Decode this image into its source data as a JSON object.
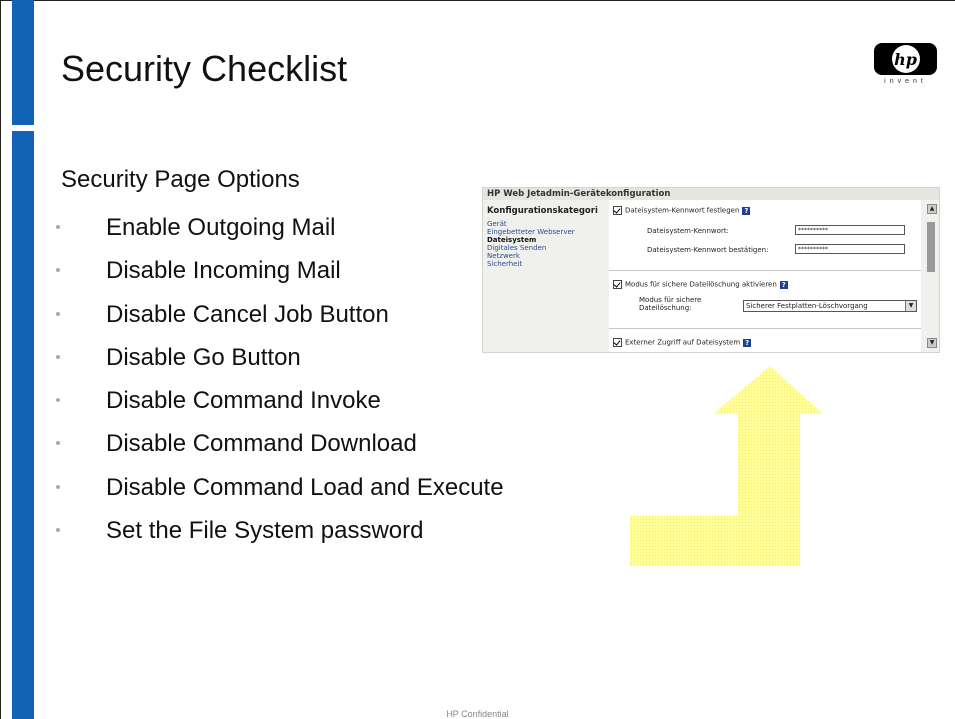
{
  "slide": {
    "title": "Security Checklist",
    "subtitle": "Security Page Options",
    "bullets": [
      "Enable Outgoing Mail",
      "Disable Incoming Mail",
      "Disable Cancel Job Button",
      "Disable Go Button",
      "Disable Command Invoke",
      "Disable Command Download",
      "Disable Command Load and Execute",
      "Set the File System password"
    ],
    "footer": "HP Confidential"
  },
  "logo": {
    "mark": "hp",
    "tagline": "invent"
  },
  "screenshot": {
    "header": "HP Web Jetadmin-Gerätekonfiguration",
    "sidebar_title": "Konfigurationskategori",
    "nav": [
      "Gerät",
      "Eingebetteter Webserver",
      "Dateisystem",
      "Digitales Senden",
      "Netzwerk",
      "Sicherheit"
    ],
    "nav_active_index": 2,
    "checkbox1_label": "Dateisystem-Kennwort festlegen",
    "password_label": "Dateisystem-Kennwort:",
    "password_value": "**********",
    "confirm_label": "Dateisystem-Kennwort bestätigen:",
    "confirm_value": "**********",
    "checkbox2_label": "Modus für sichere Dateilöschung aktivieren",
    "mode_label": "Modus für sichere Dateilöschung:",
    "mode_value": "Sicherer Festplatten-Löschvorgang",
    "checkbox3_label": "Externer Zugriff auf Dateisystem",
    "help_glyph": "?"
  },
  "colors": {
    "accent_bar": "#1263b5",
    "arrow_fill": "#ffff99"
  }
}
